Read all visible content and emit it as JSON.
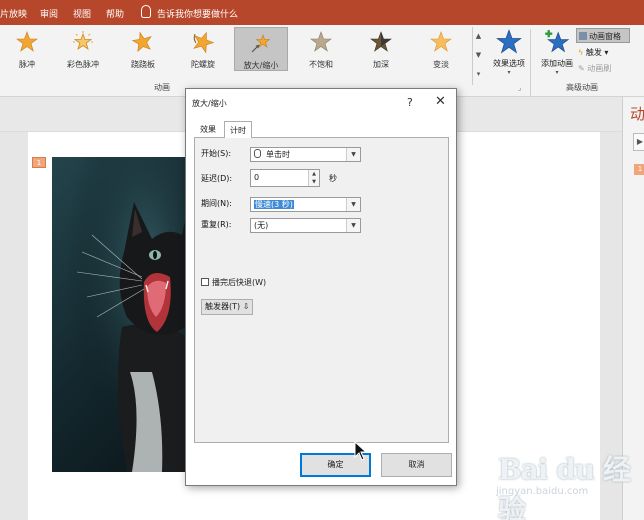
{
  "menubar": {
    "items": [
      "片放映",
      "审阅",
      "视图",
      "帮助"
    ],
    "tellme": "告诉我你想要做什么"
  },
  "ribbon": {
    "effects": [
      {
        "label": "脉冲",
        "icon": "pulse-star-icon"
      },
      {
        "label": "彩色脉冲",
        "icon": "color-pulse-star-icon"
      },
      {
        "label": "跷跷板",
        "icon": "teeter-star-icon"
      },
      {
        "label": "陀螺旋",
        "icon": "spin-star-icon"
      },
      {
        "label": "放大/缩小",
        "icon": "grow-shrink-star-icon"
      },
      {
        "label": "不饱和",
        "icon": "desaturate-star-icon"
      },
      {
        "label": "加深",
        "icon": "darken-star-icon"
      },
      {
        "label": "变淡",
        "icon": "lighten-star-icon"
      }
    ],
    "animation_group_label": "动画",
    "effect_options_label": "效果选项",
    "add_animation_label": "添加动画",
    "animation_pane_label": "动画窗格",
    "trigger_label": "触发",
    "animation_painter_label": "动画刷",
    "advanced_group_label": "高级动画"
  },
  "slide": {
    "number": "1"
  },
  "right_panel": {
    "title": "动",
    "badge": "1"
  },
  "watermark": {
    "brand": "Bai du 经验",
    "url": "jingyan.baidu.com"
  },
  "dialog": {
    "title": "放大/缩小",
    "help": "?",
    "close": "✕",
    "tabs": [
      "效果",
      "计时"
    ],
    "start_label": "开始(S):",
    "start_value": "单击时",
    "delay_label": "延迟(D):",
    "delay_value": "0",
    "delay_unit": "秒",
    "duration_label": "期间(N):",
    "duration_value": "慢速(3 秒)",
    "repeat_label": "重复(R):",
    "repeat_value": "(无)",
    "rewind_label": "播完后快退(W)",
    "trigger_button": "触发器(T)",
    "ok": "确定",
    "cancel": "取消"
  },
  "colors": {
    "menubar": "#b7472a",
    "star": "#f2a531",
    "accent_blue": "#3f8bd6"
  }
}
